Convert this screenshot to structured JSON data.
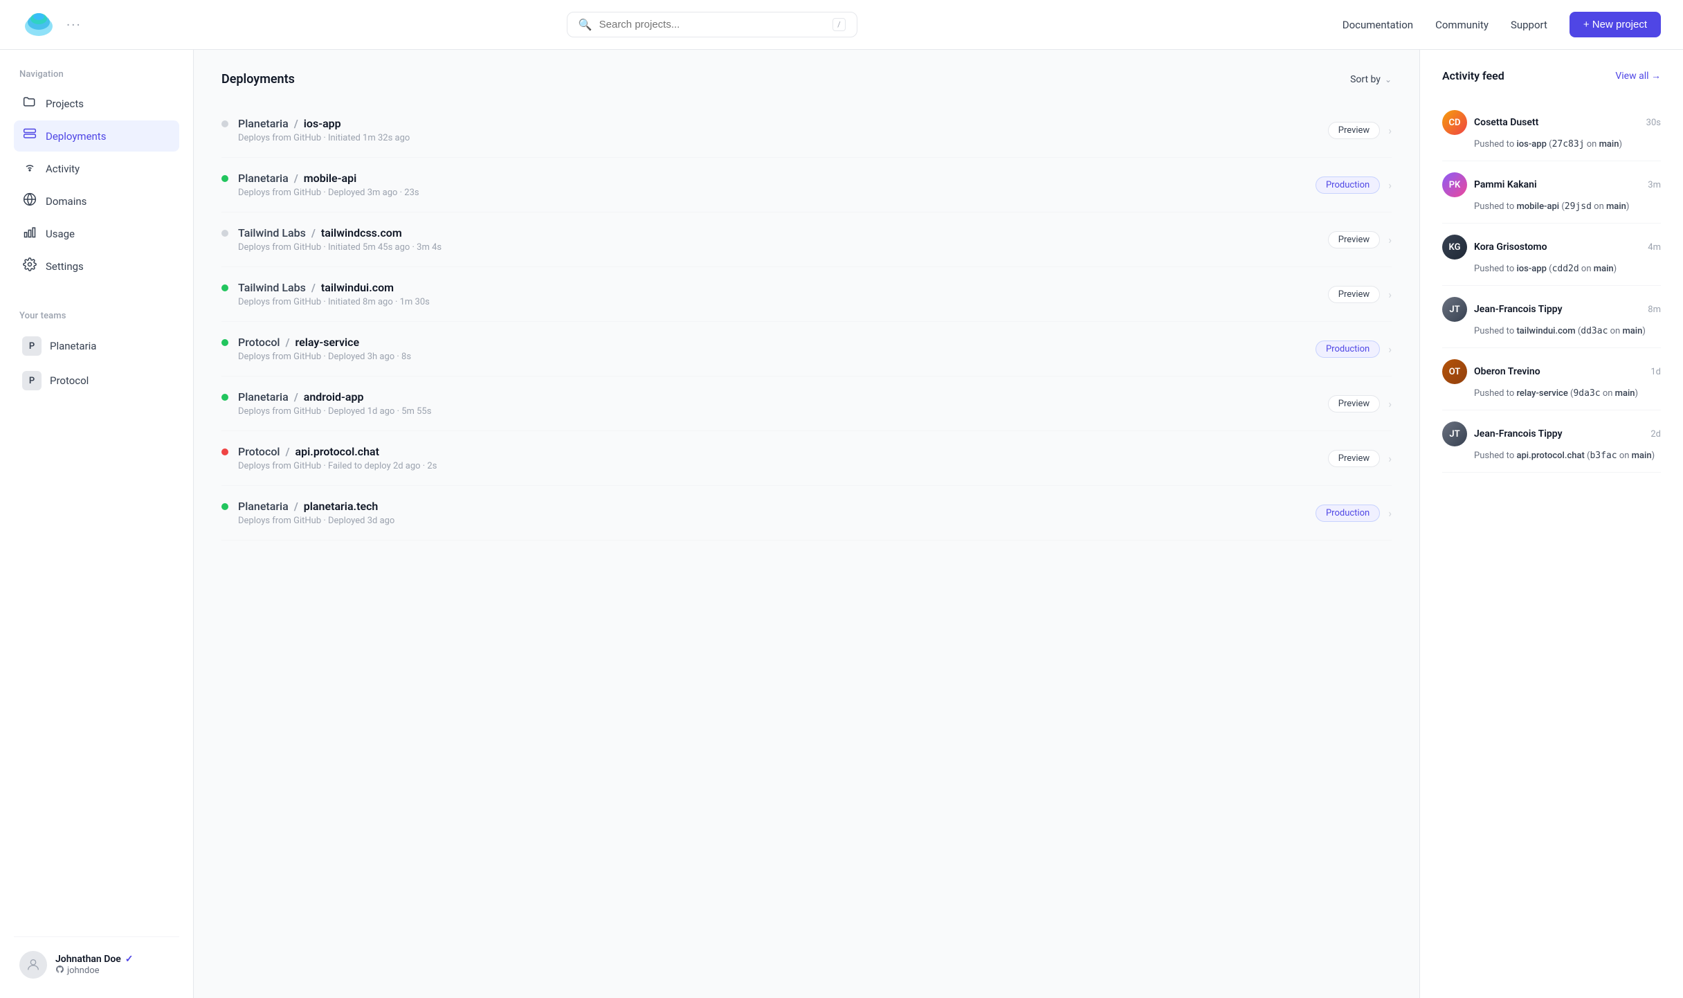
{
  "topbar": {
    "search_placeholder": "Search projects...",
    "search_kbd": "/",
    "nav_links": [
      "Documentation",
      "Community",
      "Support"
    ],
    "new_project_label": "+ New project"
  },
  "sidebar": {
    "nav_label": "Navigation",
    "nav_items": [
      {
        "id": "projects",
        "label": "Projects",
        "icon": "folder"
      },
      {
        "id": "deployments",
        "label": "Deployments",
        "icon": "server",
        "active": true
      },
      {
        "id": "activity",
        "label": "Activity",
        "icon": "wifi"
      },
      {
        "id": "domains",
        "label": "Domains",
        "icon": "globe"
      },
      {
        "id": "usage",
        "label": "Usage",
        "icon": "bar-chart"
      },
      {
        "id": "settings",
        "label": "Settings",
        "icon": "gear"
      }
    ],
    "teams_label": "Your teams",
    "teams": [
      {
        "id": "planetaria",
        "label": "Planetaria",
        "initial": "P"
      },
      {
        "id": "protocol",
        "label": "Protocol",
        "initial": "P"
      }
    ],
    "user": {
      "name": "Johnathan Doe",
      "handle": "johndoe",
      "verified": true
    }
  },
  "deployments": {
    "title": "Deployments",
    "sort_by": "Sort by",
    "items": [
      {
        "team": "Planetaria",
        "project": "ios-app",
        "status": "gray",
        "source": "Deploys from GitHub",
        "time": "Initiated 1m 32s ago",
        "duration": null,
        "badge": "Preview",
        "badge_type": "preview"
      },
      {
        "team": "Planetaria",
        "project": "mobile-api",
        "status": "green",
        "source": "Deploys from GitHub",
        "time": "Deployed 3m ago",
        "duration": "23s",
        "badge": "Production",
        "badge_type": "production"
      },
      {
        "team": "Tailwind Labs",
        "project": "tailwindcss.com",
        "status": "gray",
        "source": "Deploys from GitHub",
        "time": "Initiated 5m 45s ago",
        "duration": "3m 4s",
        "badge": "Preview",
        "badge_type": "preview"
      },
      {
        "team": "Tailwind Labs",
        "project": "tailwindui.com",
        "status": "green",
        "source": "Deploys from GitHub",
        "time": "Initiated 8m ago",
        "duration": "1m 30s",
        "badge": "Preview",
        "badge_type": "preview"
      },
      {
        "team": "Protocol",
        "project": "relay-service",
        "status": "green",
        "source": "Deploys from GitHub",
        "time": "Deployed 3h ago",
        "duration": "8s",
        "badge": "Production",
        "badge_type": "production"
      },
      {
        "team": "Planetaria",
        "project": "android-app",
        "status": "green",
        "source": "Deploys from GitHub",
        "time": "Deployed 1d ago",
        "duration": "5m 55s",
        "badge": "Preview",
        "badge_type": "preview"
      },
      {
        "team": "Protocol",
        "project": "api.protocol.chat",
        "status": "red",
        "source": "Deploys from GitHub",
        "time": "Failed to deploy 2d ago",
        "duration": "2s",
        "badge": "Preview",
        "badge_type": "preview"
      },
      {
        "team": "Planetaria",
        "project": "planetaria.tech",
        "status": "green",
        "source": "Deploys from GitHub",
        "time": "Deployed 3d ago",
        "duration": null,
        "badge": "Production",
        "badge_type": "production"
      }
    ]
  },
  "activity": {
    "title": "Activity feed",
    "view_all": "View all →",
    "items": [
      {
        "user": "Cosetta Dusett",
        "time": "30s",
        "action": "Pushed to",
        "target": "ios-app",
        "commit": "27c83j",
        "branch": "main",
        "avatar_class": "av-cosetta"
      },
      {
        "user": "Pammi Kakani",
        "time": "3m",
        "action": "Pushed to",
        "target": "mobile-api",
        "commit": "29jsd",
        "branch": "main",
        "avatar_class": "av-pammi"
      },
      {
        "user": "Kora Grisostomo",
        "time": "4m",
        "action": "Pushed to",
        "target": "ios-app",
        "commit": "cdd2d",
        "branch": "main",
        "avatar_class": "av-kora"
      },
      {
        "user": "Jean-Francois Tippy",
        "time": "8m",
        "action": "Pushed to",
        "target": "tailwindui.com",
        "commit": "dd3ac",
        "branch": "main",
        "avatar_class": "av-jean"
      },
      {
        "user": "Oberon Trevino",
        "time": "1d",
        "action": "Pushed to",
        "target": "relay-service",
        "commit": "9da3c",
        "branch": "main",
        "avatar_class": "av-oberon"
      },
      {
        "user": "Jean-Francois Tippy",
        "time": "2d",
        "action": "Pushed to",
        "target": "api.protocol.chat",
        "commit": "b3fac",
        "branch": "main",
        "avatar_class": "av-jean2"
      }
    ]
  }
}
